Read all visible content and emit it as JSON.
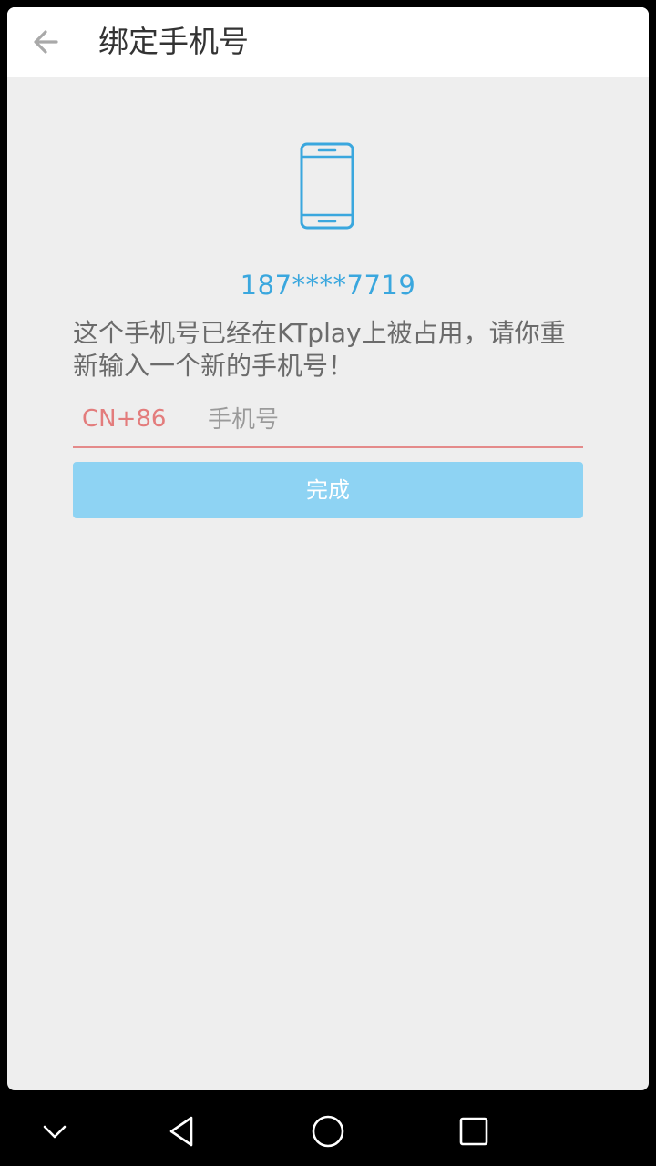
{
  "header": {
    "back_icon": "arrow-left-icon",
    "title": "绑定手机号"
  },
  "main": {
    "icon": "smartphone-icon",
    "masked_phone": "187****7719",
    "message": "这个手机号已经在KTplay上被占用，请你重新输入一个新的手机号！",
    "country_code": "CN+86",
    "phone_placeholder": "手机号",
    "phone_value": "",
    "done_label": "完成"
  },
  "nav_bar": {
    "icons": [
      "chevron-down-icon",
      "back-triangle-icon",
      "home-circle-icon",
      "recent-apps-square-icon"
    ]
  },
  "colors": {
    "accent_blue": "#3aa7de",
    "button_blue": "#8ed3f3",
    "error_red": "#e37c7c",
    "background": "#eeeeee"
  }
}
